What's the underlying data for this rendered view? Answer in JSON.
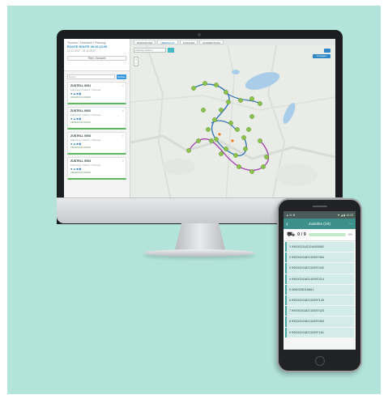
{
  "desktop": {
    "left_panel": {
      "title": "Tournée / Übersicht / Planung",
      "highlight": "ROUTE ROUTE 09:15 13.05",
      "subtitle": "14.12.2017 - 22.12.2017",
      "filter_button": "Filter / Auswahl",
      "search_placeholder": "Suche",
      "search_button": "Suchen",
      "tours": [
        {
          "name": "ZUSTELL 0001",
          "meta": "Fahrzeug / Fahrer / Tournee",
          "foot": "ABGESCHLOSSEN"
        },
        {
          "name": "ZUSTELL 0002",
          "meta": "Fahrzeug / Fahrer / Tournee",
          "foot": "ABGESCHLOSSEN"
        },
        {
          "name": "ZUSTELL 0003",
          "meta": "Fahrzeug / Fahrer / Tournee",
          "foot": "ABGESCHLOSSEN"
        },
        {
          "name": "ZUSTELL 0004",
          "meta": "Fahrzeug / Fahrer / Tournee",
          "foot": "ABGESCHLOSSEN"
        }
      ]
    },
    "tabs": [
      {
        "label": "DISPOSITION"
      },
      {
        "label": "ÜBERSICHT"
      },
      {
        "label": "PLANUNG"
      },
      {
        "label": "AUSWERTUNG"
      }
    ],
    "map": {
      "search_placeholder": "Adresse suchen",
      "apply_button": "Anzeigen",
      "colors": {
        "route_a": "#3a76b6",
        "route_b": "#a64bb0",
        "stop": "#8bc34a",
        "lake": "#a9cce8"
      }
    }
  },
  "phone": {
    "status_left": "▲ ✉ ⚙",
    "status_right": "▼ ◢ ▮ 10:23",
    "title": "Zustellen (1/9)",
    "progress_text": "0 / 9",
    "progress_pct": "0%",
    "items": [
      "1  9900021182116445580",
      "2  9900024182115397464",
      "3  9900024182115397442",
      "4  9900024182115397414",
      "5  4060306116661",
      "6  9900024182115397149",
      "7  9900024182115397423",
      "8  9900024182115397453",
      "9  9900024182115397161"
    ]
  }
}
